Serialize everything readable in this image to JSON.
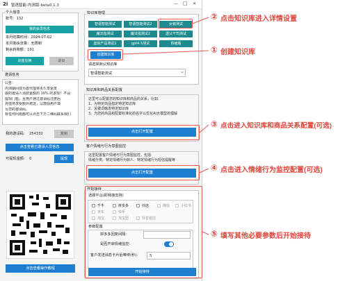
{
  "window": {
    "logo": "2i",
    "title": "智语智能-内测版-beta0.1.3",
    "controls": [
      "—",
      "□",
      "✕"
    ]
  },
  "account": {
    "section_title": "个人信息",
    "account_line": "账号：132",
    "membership_button": "我的会员信息",
    "expiry_line": "本月结算时间：2024-07-02",
    "sales_line": "本月剩余流量：无限制",
    "balance_line": "剩余转账额：191",
    "recharge_button": "充值兑换",
    "logout_button": "退出"
  },
  "invite": {
    "section_title": "邀请任务",
    "notice_lines": [
      "公告：",
      "内测期间成为首代理将永久享受发",
      "展的邀请人消费金额的 10% 的返现！不设",
      "提现门槛，且用户通过邀请码注册后",
      "充值将享受额外赠送，以鼓励用户填",
      "写您的邀请码。",
      "有任何问题都可以点击下方二维码联系我们"
    ],
    "code_label": "我的邀请码:",
    "code_value": "254332",
    "copy_button": "复制",
    "invited_button": "点击查看已邀请人员信息",
    "withdraw_label": "可提现金额:",
    "withdraw_value": "0",
    "withdraw_button": "提现"
  },
  "tutorial_button": "点击查看操作教程",
  "kb": {
    "section_title": "知识库管理",
    "items": [
      "智语智能测试",
      "智语智能测试2",
      "女装测试",
      "魔法指测试",
      "魔法指测试2",
      "透父干司测试",
      "虚拟产品测试1",
      "gpt4.5测试",
      "热锤版"
    ],
    "create_button": "创建知识库",
    "select_label": "请选择默认知识库",
    "select_value": "智语智能测试",
    "chevron": "⌄"
  },
  "product_cfg": {
    "section_title": "知识库和商品关系配置",
    "lines": [
      "这里可以配置您的知识库和商品的关系，比如:",
      "1、为特定商品指定特定知识库",
      "2、关键词触发特定知识库",
      "3、为您的商品和配置标准化的名字以优化AI大模型的理解"
    ],
    "button": "点击打开配置"
  },
  "behavior_cfg": {
    "section_title": "客户情绪与行为意图监控",
    "lines": [
      "这里配置客户情绪与行为意图监控，包括:",
      "情绪分类、特定情绪行为转人、特定情绪行为短信提醒等"
    ],
    "button": "点击打开配置"
  },
  "reception": {
    "section_title": "开始接待",
    "platform_label": "选择平台(即我接支持)",
    "platforms": [
      "千牛",
      "拼多多",
      "抖店",
      "微信",
      "小红书",
      "京东",
      "快手"
    ],
    "extra_options": [
      "淘宝",
      "淘宝团",
      "抖音首店"
    ],
    "params_title": "参数配置",
    "reply_interval_label": "拼多多回复间隔:",
    "auto_transfer_label": "是否开启情绪监控:",
    "send_message_label": "客户发送消息卡片后等待(秒):",
    "send_message_value": "5",
    "start_button": "开始接待"
  },
  "annotations": [
    {
      "num": "②",
      "text": "点击知识库进入详情设置"
    },
    {
      "num": "①",
      "text": "创建知识库"
    },
    {
      "num": "③",
      "text": "点击进入知识库和商品关系配置(可选)"
    },
    {
      "num": "④",
      "text": "点击进入情绪行为监控配置(可选)"
    },
    {
      "num": "⑤",
      "text": "填写其他必要参数后开始接待"
    }
  ],
  "colors": {
    "accent_blue": "#1e7fd0",
    "teal": "#1c8a8f",
    "annotation_red": "#e0463d",
    "toggle_blue": "#1e7fd0"
  }
}
